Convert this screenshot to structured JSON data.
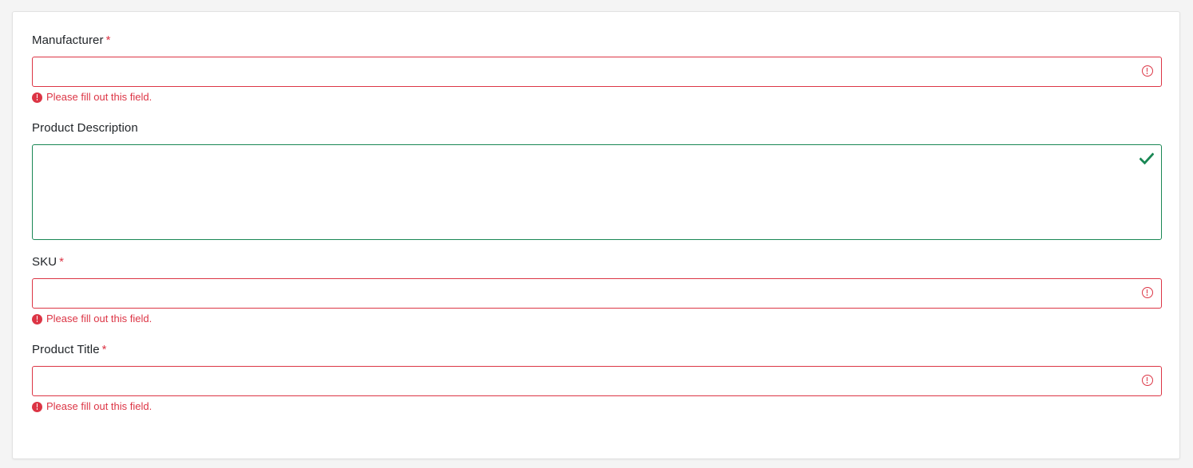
{
  "form": {
    "manufacturer": {
      "label": "Manufacturer",
      "required_mark": "*",
      "value": "",
      "error": "Please fill out this field."
    },
    "description": {
      "label": "Product Description",
      "value": ""
    },
    "sku": {
      "label": "SKU",
      "required_mark": "*",
      "value": "",
      "error": "Please fill out this field."
    },
    "title": {
      "label": "Product Title",
      "required_mark": "*",
      "value": "",
      "error": "Please fill out this field."
    }
  },
  "icons": {
    "invalid": "exclamation-circle-icon",
    "valid": "checkmark-icon"
  },
  "colors": {
    "invalid": "#dc3545",
    "valid": "#198754",
    "text": "#212529"
  }
}
